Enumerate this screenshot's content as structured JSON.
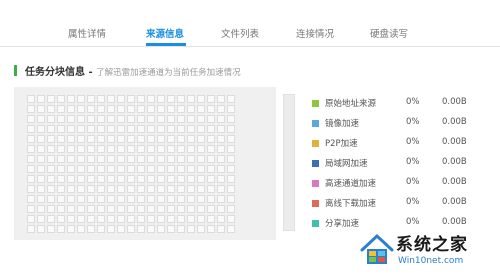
{
  "tabs": [
    {
      "label": "属性详情",
      "active": false
    },
    {
      "label": "来源信息",
      "active": true
    },
    {
      "label": "文件列表",
      "active": false
    },
    {
      "label": "连接情况",
      "active": false
    },
    {
      "label": "硬盘读写",
      "active": false
    }
  ],
  "section": {
    "title": "任务分块信息",
    "separator": " - ",
    "subtitle": "了解迅雷加速通道为当前任务加速情况"
  },
  "legend": [
    {
      "label": "原始地址来源",
      "percent": "0%",
      "size": "0.00B",
      "color": "#8dc63f"
    },
    {
      "label": "镜像加速",
      "percent": "0%",
      "size": "0.00B",
      "color": "#5aa8e0"
    },
    {
      "label": "P2P加速",
      "percent": "0%",
      "size": "0.00B",
      "color": "#e0b23a"
    },
    {
      "label": "局域网加速",
      "percent": "0%",
      "size": "0.00B",
      "color": "#3d6fb5"
    },
    {
      "label": "高速通道加速",
      "percent": "0%",
      "size": "0.00B",
      "color": "#d878c0"
    },
    {
      "label": "离线下载加速",
      "percent": "0%",
      "size": "0.00B",
      "color": "#e06a5a"
    },
    {
      "label": "分享加速",
      "percent": "0%",
      "size": "0.00B",
      "color": "#3fbfb0"
    }
  ],
  "watermark": {
    "text": "系统之家",
    "url": "Win10net.com"
  }
}
